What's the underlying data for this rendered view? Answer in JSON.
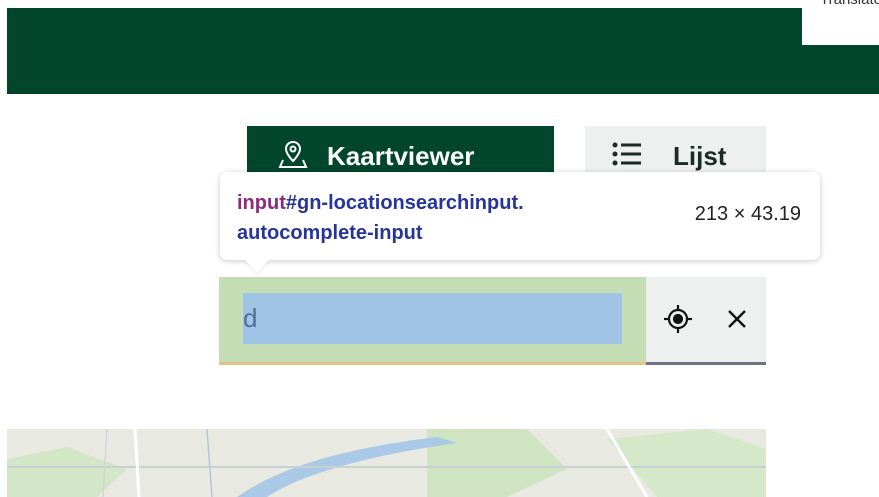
{
  "header": {
    "translate_label": "Translate"
  },
  "view_toggle": {
    "map_label": "Kaartviewer",
    "list_label": "Lijst"
  },
  "search": {
    "value": "d"
  },
  "devtools_tooltip": {
    "selector_tag": "input",
    "selector_line1_rest": "#gn-locationsearchinput.",
    "selector_line2": "autocomplete-input",
    "dimensions": "213 × 43.19"
  },
  "icons": {
    "map": "map-pin-icon",
    "list": "list-icon",
    "locate": "crosshair-icon",
    "clear": "close-icon"
  },
  "colors": {
    "brand_green": "#00452c",
    "highlight_padding": "#c4ddb4",
    "highlight_content": "#9fc4e6",
    "button_grey": "#eef0ef"
  }
}
